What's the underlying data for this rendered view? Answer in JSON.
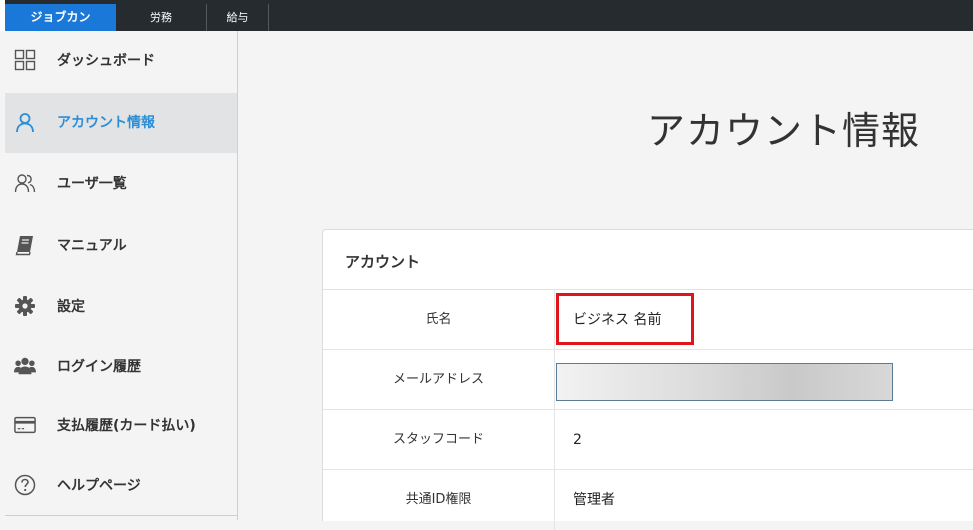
{
  "tabs": [
    {
      "label": "ジョブカン"
    },
    {
      "label": "労務"
    },
    {
      "label": "給与"
    }
  ],
  "sidebar": {
    "items": [
      {
        "label": "ダッシュボード",
        "icon": "dashboard-grid-icon"
      },
      {
        "label": "アカウント情報",
        "icon": "user-icon",
        "active": true
      },
      {
        "label": "ユーザ一覧",
        "icon": "users-icon"
      },
      {
        "label": "マニュアル",
        "icon": "book-icon"
      },
      {
        "label": "設定",
        "icon": "gear-icon"
      },
      {
        "label": "ログイン履歴",
        "icon": "group-icon"
      },
      {
        "label": "支払履歴(カード払い)",
        "icon": "credit-card-icon"
      },
      {
        "label": "ヘルプページ",
        "icon": "help-circle-icon"
      }
    ]
  },
  "page": {
    "title": "アカウント情報"
  },
  "account": {
    "heading": "アカウント",
    "rows": [
      {
        "label": "氏名",
        "value": "ビジネス 名前"
      },
      {
        "label": "メールアドレス",
        "value": ""
      },
      {
        "label": "スタッフコード",
        "value": "2"
      },
      {
        "label": "共通ID権限",
        "value": "管理者"
      }
    ]
  },
  "colors": {
    "brand": "#1a79d8",
    "topbar": "#262b2f",
    "active_nav": "#2b8ed6",
    "highlight": "#e0141b"
  }
}
